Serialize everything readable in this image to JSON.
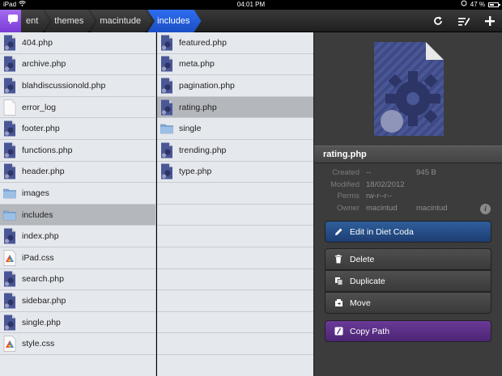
{
  "status_bar": {
    "device": "iPad",
    "time": "04:01 PM",
    "battery": "47 %",
    "battery_level": 0.47
  },
  "toolbar": {
    "breadcrumbs": [
      {
        "label": "ent"
      },
      {
        "label": "themes"
      },
      {
        "label": "macintude"
      },
      {
        "label": "includes"
      }
    ],
    "icons": [
      "refresh-icon",
      "edit-list-icon",
      "add-icon"
    ]
  },
  "column1": {
    "items": [
      {
        "name": "404.php",
        "icon": "php-file-icon"
      },
      {
        "name": "archive.php",
        "icon": "php-file-icon"
      },
      {
        "name": "blahdiscussionold.php",
        "icon": "php-file-icon"
      },
      {
        "name": "error_log",
        "icon": "plain-file-icon"
      },
      {
        "name": "footer.php",
        "icon": "php-file-icon"
      },
      {
        "name": "functions.php",
        "icon": "php-file-icon"
      },
      {
        "name": "header.php",
        "icon": "php-file-icon"
      },
      {
        "name": "images",
        "icon": "folder-icon"
      },
      {
        "name": "includes",
        "icon": "folder-icon"
      },
      {
        "name": "index.php",
        "icon": "php-file-icon"
      },
      {
        "name": "iPad.css",
        "icon": "css-file-icon"
      },
      {
        "name": "search.php",
        "icon": "php-file-icon"
      },
      {
        "name": "sidebar.php",
        "icon": "php-file-icon"
      },
      {
        "name": "single.php",
        "icon": "php-file-icon"
      },
      {
        "name": "style.css",
        "icon": "css-file-icon"
      }
    ],
    "selected": "includes"
  },
  "column2": {
    "items": [
      {
        "name": "featured.php",
        "icon": "php-file-icon"
      },
      {
        "name": "meta.php",
        "icon": "php-file-icon"
      },
      {
        "name": "pagination.php",
        "icon": "php-file-icon"
      },
      {
        "name": "rating.php",
        "icon": "php-file-icon"
      },
      {
        "name": "single",
        "icon": "folder-icon"
      },
      {
        "name": "trending.php",
        "icon": "php-file-icon"
      },
      {
        "name": "type.php",
        "icon": "php-file-icon"
      }
    ],
    "selected": "rating.php"
  },
  "info_panel": {
    "filename": "rating.php",
    "created_label": "Created",
    "created_value": "--",
    "size": "945 B",
    "modified_label": "Modified",
    "modified_value": "18/02/2012",
    "perms_label": "Perms",
    "perms_value": "rw-r--r--",
    "owner_label": "Owner",
    "owner_value": "macintud",
    "group_value": "macintud",
    "actions": {
      "edit": "Edit in Diet Coda",
      "delete": "Delete",
      "duplicate": "Duplicate",
      "move": "Move",
      "copy_path": "Copy Path"
    }
  },
  "colors": {
    "accent_blue": "#2f6df0",
    "app_purple": "#8a4ee0",
    "edit_button": "#2a558e",
    "copy_button": "#5e3289"
  }
}
